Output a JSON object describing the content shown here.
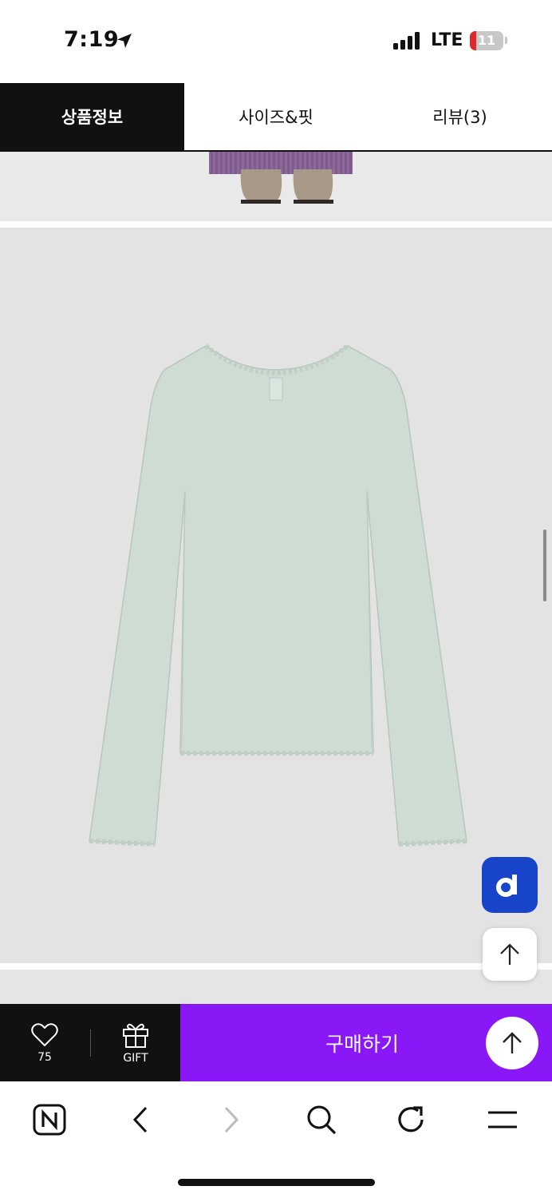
{
  "status_bar": {
    "time": "7:19",
    "carrier": "LTE",
    "battery": "11"
  },
  "tabs": [
    {
      "label": "상품정보",
      "active": true
    },
    {
      "label": "사이즈&핏",
      "active": false
    },
    {
      "label": "리뷰(3)",
      "active": false
    }
  ],
  "floating": {
    "brand_badge": "d"
  },
  "purchase_bar": {
    "like_count": "75",
    "gift_label": "GIFT",
    "buy_label": "구매하기"
  },
  "colors": {
    "accent": "#8a17f5",
    "badge_blue": "#1744c9",
    "dark": "#111111",
    "garment": "#cfdcd4"
  },
  "icons": {
    "like": "heart-icon",
    "gift": "gift-icon",
    "top": "arrow-up-icon",
    "toolbar": [
      "naver-home-icon",
      "back-icon",
      "forward-icon",
      "search-icon",
      "refresh-icon",
      "menu-icon"
    ]
  }
}
